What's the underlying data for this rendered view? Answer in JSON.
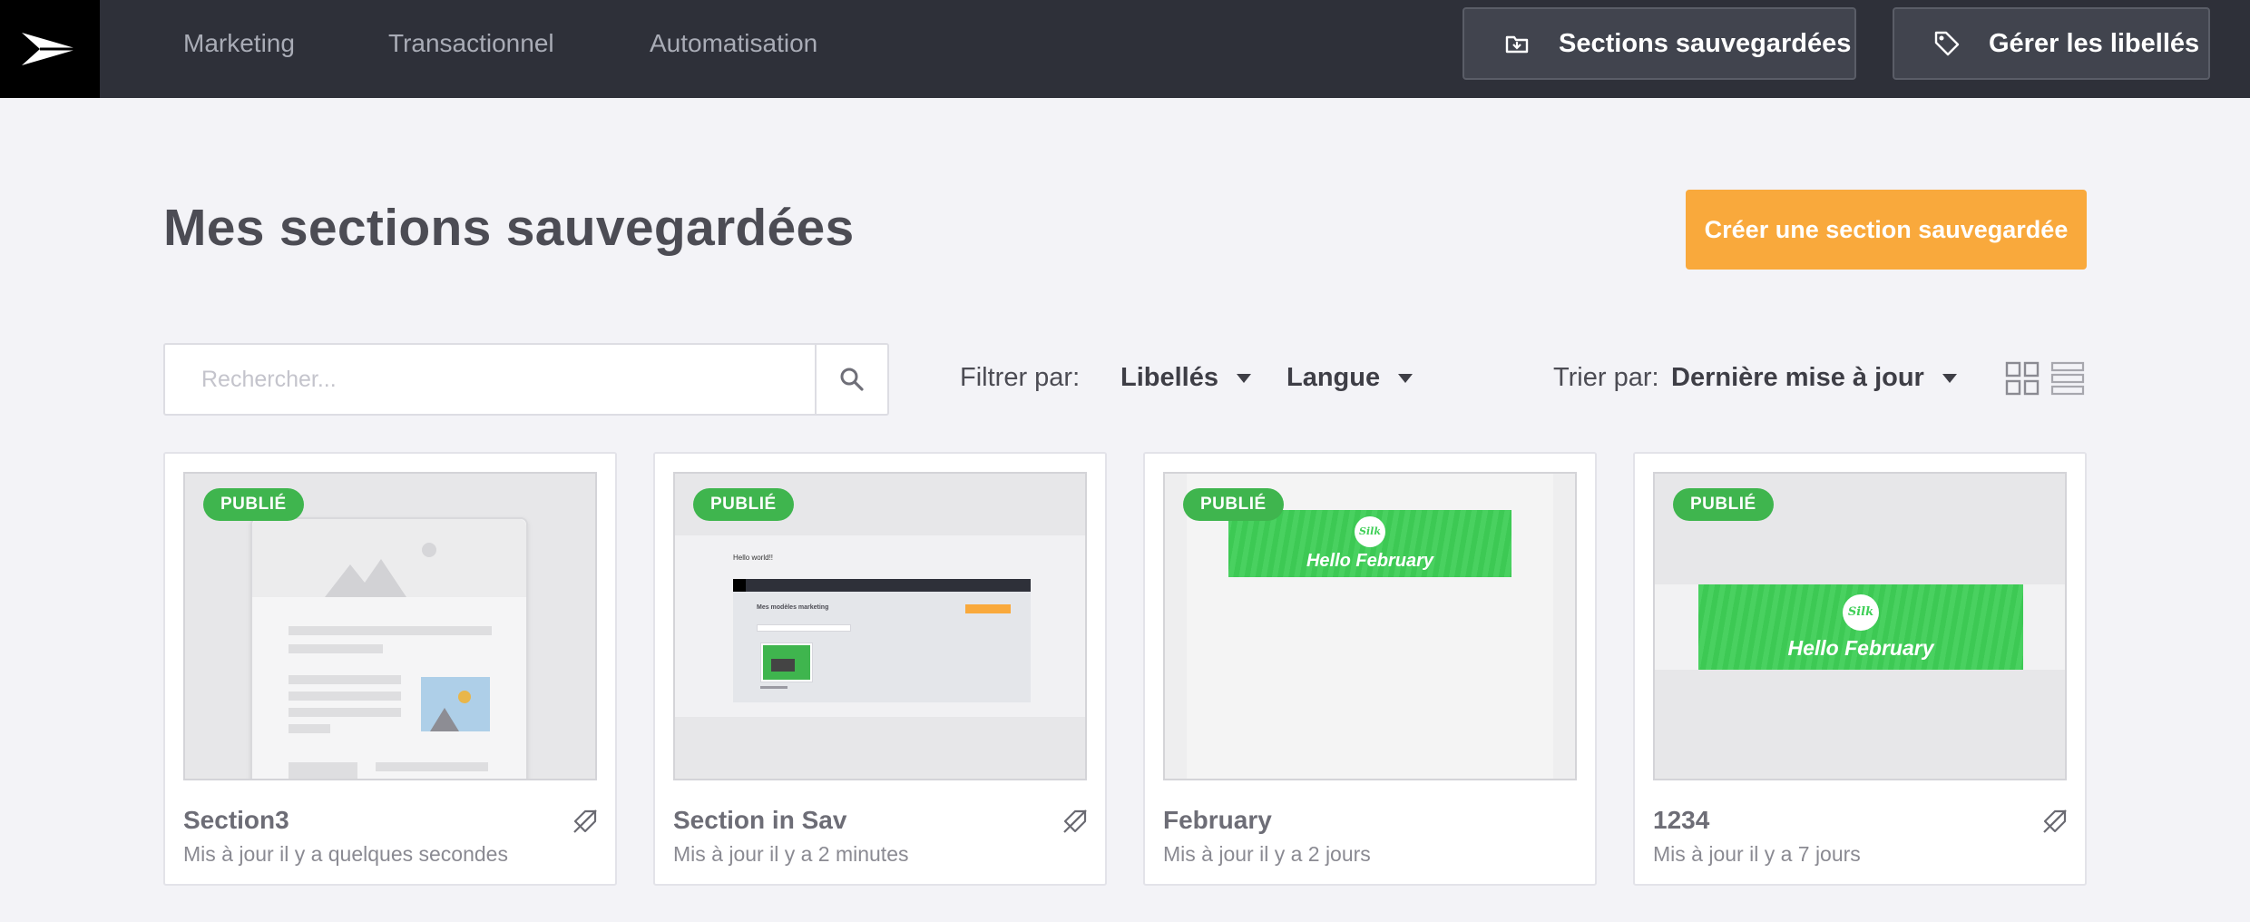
{
  "nav": {
    "items": [
      "Marketing",
      "Transactionnel",
      "Automatisation"
    ],
    "saved_sections_label": "Sections sauvegardées",
    "manage_labels_label": "Gérer les libellés"
  },
  "header": {
    "title": "Mes sections sauvegardées",
    "create_label": "Créer une section sauvegardée"
  },
  "toolbar": {
    "search_placeholder": "Rechercher...",
    "search_value": "",
    "filter_label": "Filtrer par:",
    "filter_labels": "Libellés",
    "filter_language": "Langue",
    "sort_label": "Trier par:",
    "sort_value": "Dernière mise à jour"
  },
  "cards": [
    {
      "badge": "PUBLIÉ",
      "title": "Section3",
      "updated": "Mis à jour il y a quelques secondes",
      "has_label_icon": true
    },
    {
      "badge": "PUBLIÉ",
      "title": "Section in Sav",
      "updated": "Mis à jour il y a 2 minutes",
      "has_label_icon": true,
      "preview": {
        "heading": "Hello world!!",
        "app_title": "Mes modèles marketing"
      }
    },
    {
      "badge": "PUBLIÉ",
      "title": "February",
      "updated": "Mis à jour il y a 2 jours",
      "has_label_icon": false,
      "preview": {
        "logo": "Silk",
        "text": "Hello February"
      }
    },
    {
      "badge": "PUBLIÉ",
      "title": "1234",
      "updated": "Mis à jour il y a 7 jours",
      "has_label_icon": true,
      "preview": {
        "logo": "Silk",
        "text": "Hello February"
      }
    }
  ],
  "colors": {
    "topbar": "#2e3039",
    "accent": "#f9a93c",
    "published": "#3fb54e",
    "banner": "#3fcf57"
  }
}
